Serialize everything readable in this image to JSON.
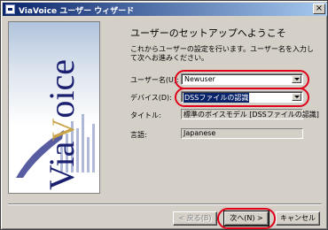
{
  "window": {
    "title": "ViaVoice ユーザー ウィザード",
    "close": "×"
  },
  "logo": {
    "part1": "Via",
    "part2": "V",
    "part3": "oice"
  },
  "content": {
    "heading": "ユーザーのセットアップへようこそ",
    "intro": "これからユーザーの設定を行います。ユーザー名を入力して次へお進みください。"
  },
  "fields": {
    "username": {
      "label": "ユーザー名(U):",
      "value": "Newuser"
    },
    "device": {
      "label": "デバイス(D):",
      "value": "DSSファイルの認識"
    },
    "title": {
      "label": "タイトル:",
      "value": "標準のボイスモデル [DSSファイルの認識]"
    },
    "language": {
      "label": "言語:",
      "value": "Japanese"
    }
  },
  "buttons": {
    "back": "< 戻る(B)",
    "next": "次へ(N) >",
    "cancel": "キャンセル"
  },
  "colors": {
    "highlight": "#e0001a",
    "titlebar": "#0a246a",
    "face": "#d4d0c8"
  }
}
